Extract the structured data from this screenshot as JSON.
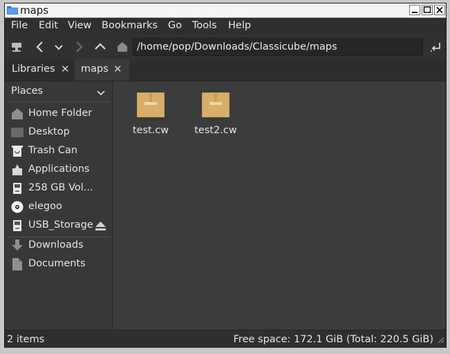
{
  "window": {
    "title": "maps",
    "controls": [
      "minimize-icon",
      "maximize-icon",
      "close-icon"
    ]
  },
  "menu": [
    "File",
    "Edit",
    "View",
    "Bookmarks",
    "Go",
    "Tools",
    "Help"
  ],
  "toolbar": {
    "path": "/home/pop/Downloads/Classicube/maps",
    "icons": [
      "connect-icon",
      "back-icon",
      "history-dropdown-icon",
      "forward-icon",
      "up-icon",
      "home-icon",
      "go-icon"
    ]
  },
  "tabs": [
    {
      "label": "Libraries",
      "active": false
    },
    {
      "label": "maps",
      "active": true
    }
  ],
  "sidebar": {
    "header": "Places",
    "places": [
      {
        "label": "Home Folder",
        "icon": "home-icon"
      },
      {
        "label": "Desktop",
        "icon": "desktop-icon"
      },
      {
        "label": "Trash Can",
        "icon": "trash-icon"
      },
      {
        "label": "Applications",
        "icon": "applications-icon"
      },
      {
        "label": "258 GB Vol...",
        "icon": "drive-icon"
      },
      {
        "label": "elegoo",
        "icon": "disc-icon"
      },
      {
        "label": "USB_Storage",
        "icon": "drive-icon",
        "eject": true
      }
    ],
    "bookmarks": [
      {
        "label": "Downloads",
        "icon": "download-icon"
      },
      {
        "label": "Documents",
        "icon": "document-icon"
      }
    ]
  },
  "files": [
    {
      "name": "test.cw",
      "icon": "package-icon"
    },
    {
      "name": "test2.cw",
      "icon": "package-icon"
    }
  ],
  "status": {
    "items": "2 items",
    "free_space": "Free space: 172.1 GiB (Total: 220.5 GiB)"
  },
  "colors": {
    "window_bg": "#353535",
    "sidebar_bg": "#383838",
    "content_bg": "#3c3c3c",
    "package": "#d6b06a"
  }
}
